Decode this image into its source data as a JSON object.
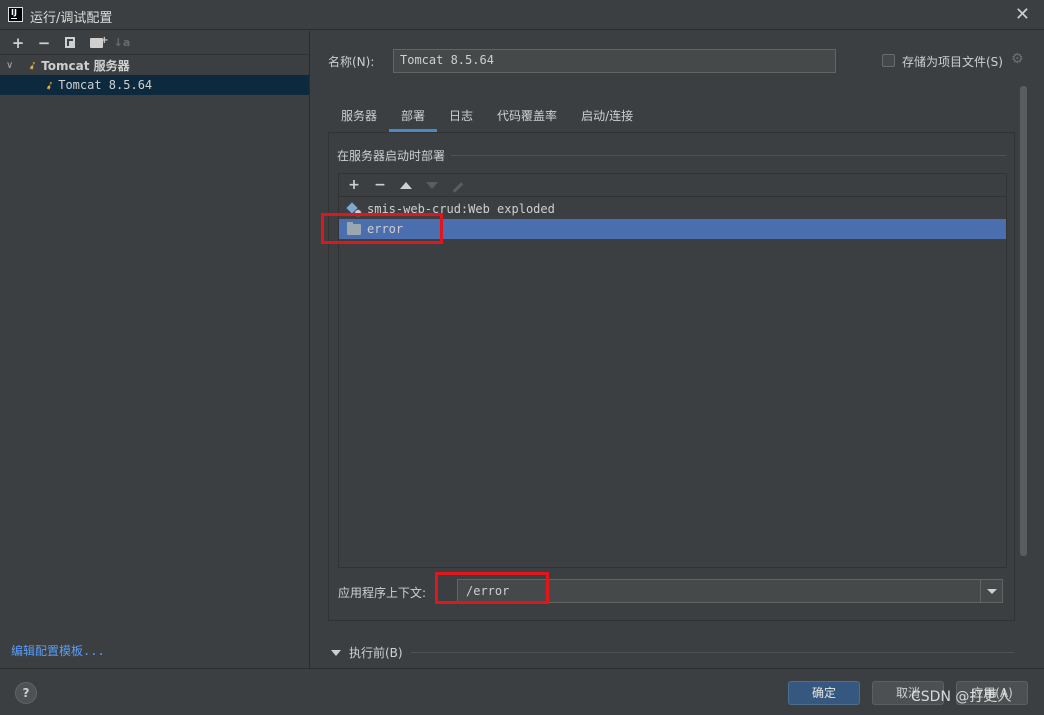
{
  "window": {
    "title": "运行/调试配置"
  },
  "left_toolbar": {
    "add": "+",
    "remove": "−",
    "sort": "↓a"
  },
  "tree": {
    "group_label": "Tomcat 服务器",
    "item_label": "Tomcat 8.5.64"
  },
  "edit_templates": "编辑配置模板...",
  "form": {
    "name_label": "名称(N):",
    "name_value": "Tomcat 8.5.64",
    "store_label": "存储为项目文件(S)"
  },
  "tabs": [
    "服务器",
    "部署",
    "日志",
    "代码覆盖率",
    "启动/连接"
  ],
  "active_tab": "部署",
  "deploy": {
    "group_title": "在服务器启动时部署",
    "list_toolbar": {
      "add": "+",
      "remove": "−"
    },
    "artifacts": [
      {
        "label": "smis-web-crud:Web exploded",
        "icon": "artifact-icon"
      },
      {
        "label": "error",
        "icon": "folder-icon"
      }
    ],
    "context_label": "应用程序上下文:",
    "context_value": "/error"
  },
  "before_launch": "执行前(B)",
  "footer": {
    "help": "?",
    "ok": "确定",
    "cancel": "取消",
    "apply": "应用(A)"
  },
  "watermark": "CSDN @打更人",
  "colors": {
    "accent": "#4a88c7",
    "selection": "#4b6eaf",
    "annotation": "#e0161c",
    "link": "#589df6"
  }
}
